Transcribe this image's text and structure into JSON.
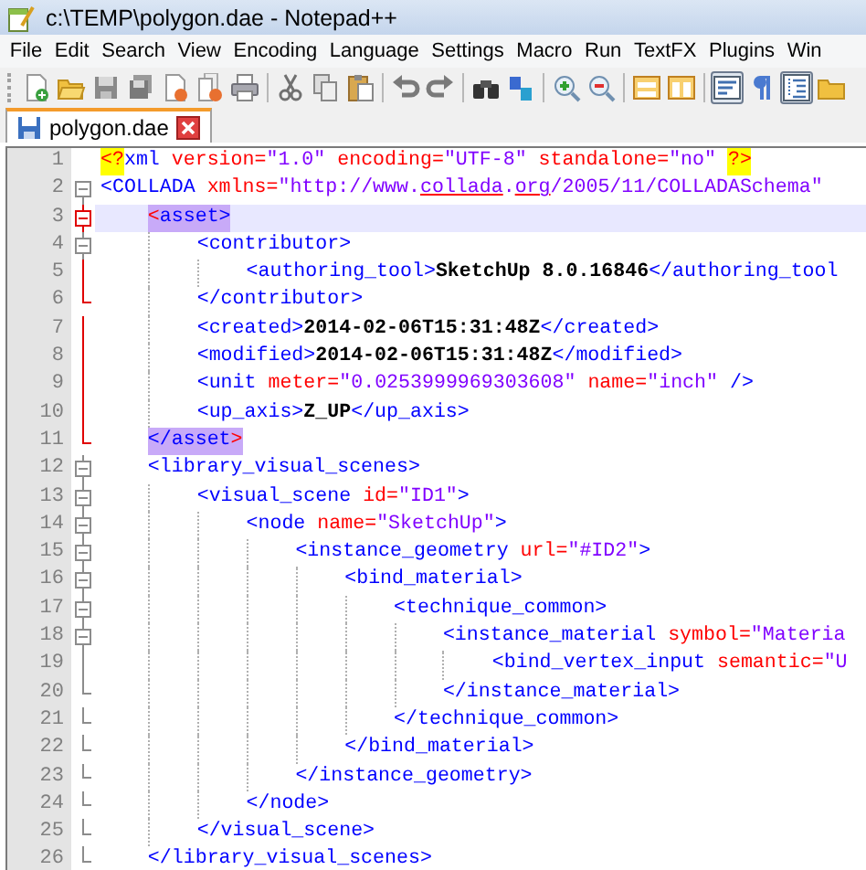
{
  "window": {
    "title": "c:\\TEMP\\polygon.dae - Notepad++"
  },
  "menu": [
    "File",
    "Edit",
    "Search",
    "View",
    "Encoding",
    "Language",
    "Settings",
    "Macro",
    "Run",
    "TextFX",
    "Plugins",
    "Win"
  ],
  "toolbar": [
    {
      "kind": "button",
      "pressed": false
    },
    {
      "kind": "button",
      "pressed": false
    },
    {
      "kind": "button",
      "pressed": false
    },
    {
      "kind": "button",
      "pressed": false
    },
    {
      "kind": "button",
      "pressed": false
    },
    {
      "kind": "button",
      "pressed": false
    },
    {
      "kind": "button",
      "pressed": false
    },
    {
      "kind": "separator"
    },
    {
      "kind": "button",
      "pressed": false
    },
    {
      "kind": "button",
      "pressed": false
    },
    {
      "kind": "button",
      "pressed": false
    },
    {
      "kind": "separator"
    },
    {
      "kind": "button",
      "pressed": false
    },
    {
      "kind": "button",
      "pressed": false
    },
    {
      "kind": "separator"
    },
    {
      "kind": "button",
      "pressed": false
    },
    {
      "kind": "button",
      "pressed": false
    },
    {
      "kind": "separator"
    },
    {
      "kind": "button",
      "pressed": false
    },
    {
      "kind": "button",
      "pressed": false
    },
    {
      "kind": "separator"
    },
    {
      "kind": "button",
      "pressed": false
    },
    {
      "kind": "button",
      "pressed": false
    },
    {
      "kind": "separator"
    },
    {
      "kind": "button",
      "pressed": true
    },
    {
      "kind": "button",
      "pressed": false
    },
    {
      "kind": "button",
      "pressed": true
    },
    {
      "kind": "button",
      "pressed": false
    }
  ],
  "tabs": [
    {
      "label": "polygon.dae",
      "selected": true
    }
  ],
  "editor": {
    "lines": [
      {
        "number": "1",
        "current": false,
        "tokens": [
          {
            "kind": "pi",
            "text": "<?",
            "highlighted": true
          },
          {
            "kind": "tag",
            "text": "xml "
          },
          {
            "kind": "attr",
            "text": "version="
          },
          {
            "kind": "value",
            "text": "\"1.0\""
          },
          {
            "kind": "attr",
            "text": " encoding="
          },
          {
            "kind": "value",
            "text": "\"UTF-8\""
          },
          {
            "kind": "attr",
            "text": " standalone="
          },
          {
            "kind": "value",
            "text": "\"no\" "
          },
          {
            "kind": "pi",
            "text": "?>",
            "highlighted": true
          }
        ]
      },
      {
        "number": "2",
        "current": false,
        "fold": {
          "kind": "open",
          "active": false
        },
        "tokens": [
          {
            "kind": "tag",
            "text": "<COLLADA "
          },
          {
            "kind": "attr",
            "text": "xmlns="
          },
          {
            "kind": "value",
            "text": "\"http://www."
          },
          {
            "kind": "value",
            "text": "collada",
            "misspelled": true
          },
          {
            "kind": "value",
            "text": "."
          },
          {
            "kind": "value",
            "text": "org",
            "misspelled": true
          },
          {
            "kind": "value",
            "text": "/2005/11/COLLADASchema\""
          }
        ]
      },
      {
        "number": "3",
        "current": true,
        "fold": {
          "kind": "open",
          "active": true
        },
        "tokens": [
          {
            "kind": "brace",
            "text": "    <",
            "highlighted": true
          },
          {
            "kind": "tag",
            "text": "asset>",
            "highlighted": true
          }
        ]
      },
      {
        "number": "4",
        "current": false,
        "fold": {
          "kind": "open",
          "active": false
        },
        "tokens": [
          {
            "kind": "tag",
            "text": "        <contributor>"
          }
        ]
      },
      {
        "number": "5",
        "current": false,
        "fold": {
          "kind": "body",
          "active": true
        },
        "tokens": [
          {
            "kind": "tag",
            "text": "            <authoring_tool>"
          },
          {
            "kind": "text",
            "text": "SketchUp 8.0.16846"
          },
          {
            "kind": "tag",
            "text": "</authoring_tool"
          }
        ]
      },
      {
        "number": "6",
        "current": false,
        "fold": {
          "kind": "end",
          "active": true
        },
        "tokens": [
          {
            "kind": "tag",
            "text": "        </contributor>"
          }
        ]
      },
      {
        "number": "7",
        "current": false,
        "fold": {
          "kind": "body",
          "active": true
        },
        "tokens": [
          {
            "kind": "tag",
            "text": "        <created>"
          },
          {
            "kind": "text",
            "text": "2014-02-06T15:31:48Z"
          },
          {
            "kind": "tag",
            "text": "</created>"
          }
        ]
      },
      {
        "number": "8",
        "current": false,
        "fold": {
          "kind": "body",
          "active": true
        },
        "tokens": [
          {
            "kind": "tag",
            "text": "        <modified>"
          },
          {
            "kind": "text",
            "text": "2014-02-06T15:31:48Z"
          },
          {
            "kind": "tag",
            "text": "</modified>"
          }
        ]
      },
      {
        "number": "9",
        "current": false,
        "fold": {
          "kind": "body",
          "active": true
        },
        "tokens": [
          {
            "kind": "tag",
            "text": "        <unit "
          },
          {
            "kind": "attr",
            "text": "meter="
          },
          {
            "kind": "value",
            "text": "\"0.0253999969303608\""
          },
          {
            "kind": "attr",
            "text": " name="
          },
          {
            "kind": "value",
            "text": "\"inch\""
          },
          {
            "kind": "tag",
            "text": " />"
          }
        ]
      },
      {
        "number": "10",
        "current": false,
        "fold": {
          "kind": "body",
          "active": true
        },
        "tokens": [
          {
            "kind": "tag",
            "text": "        <up_axis>"
          },
          {
            "kind": "text",
            "text": "Z_UP"
          },
          {
            "kind": "tag",
            "text": "</up_axis>"
          }
        ]
      },
      {
        "number": "11",
        "current": false,
        "fold": {
          "kind": "end",
          "active": true
        },
        "tokens": [
          {
            "kind": "tag",
            "text": "    </asset",
            "highlighted": true
          },
          {
            "kind": "brace",
            "text": ">",
            "highlighted": true
          }
        ]
      },
      {
        "number": "12",
        "current": false,
        "fold": {
          "kind": "open",
          "active": false
        },
        "tokens": [
          {
            "kind": "tag",
            "text": "    <library_visual_scenes>"
          }
        ]
      },
      {
        "number": "13",
        "current": false,
        "fold": {
          "kind": "open",
          "active": false
        },
        "tokens": [
          {
            "kind": "tag",
            "text": "        <visual_scene "
          },
          {
            "kind": "attr",
            "text": "id="
          },
          {
            "kind": "value",
            "text": "\"ID1\""
          },
          {
            "kind": "tag",
            "text": ">"
          }
        ]
      },
      {
        "number": "14",
        "current": false,
        "fold": {
          "kind": "open",
          "active": false
        },
        "tokens": [
          {
            "kind": "tag",
            "text": "            <node "
          },
          {
            "kind": "attr",
            "text": "name="
          },
          {
            "kind": "value",
            "text": "\"SketchUp\""
          },
          {
            "kind": "tag",
            "text": ">"
          }
        ]
      },
      {
        "number": "15",
        "current": false,
        "fold": {
          "kind": "open",
          "active": false
        },
        "tokens": [
          {
            "kind": "tag",
            "text": "                <instance_geometry "
          },
          {
            "kind": "attr",
            "text": "url="
          },
          {
            "kind": "value",
            "text": "\"#ID2\""
          },
          {
            "kind": "tag",
            "text": ">"
          }
        ]
      },
      {
        "number": "16",
        "current": false,
        "fold": {
          "kind": "open",
          "active": false
        },
        "tokens": [
          {
            "kind": "tag",
            "text": "                    <bind_material>"
          }
        ]
      },
      {
        "number": "17",
        "current": false,
        "fold": {
          "kind": "open",
          "active": false
        },
        "tokens": [
          {
            "kind": "tag",
            "text": "                        <technique_common>"
          }
        ]
      },
      {
        "number": "18",
        "current": false,
        "fold": {
          "kind": "open",
          "active": false
        },
        "tokens": [
          {
            "kind": "tag",
            "text": "                            <instance_material "
          },
          {
            "kind": "attr",
            "text": "symbol="
          },
          {
            "kind": "value",
            "text": "\"Materia"
          }
        ]
      },
      {
        "number": "19",
        "current": false,
        "fold": {
          "kind": "body",
          "active": false
        },
        "tokens": [
          {
            "kind": "tag",
            "text": "                                <bind_vertex_input "
          },
          {
            "kind": "attr",
            "text": "semantic="
          },
          {
            "kind": "value",
            "text": "\"U"
          }
        ]
      },
      {
        "number": "20",
        "current": false,
        "fold": {
          "kind": "end",
          "active": false
        },
        "tokens": [
          {
            "kind": "tag",
            "text": "                            </instance_material>"
          }
        ]
      },
      {
        "number": "21",
        "current": false,
        "fold": {
          "kind": "end",
          "active": false
        },
        "tokens": [
          {
            "kind": "tag",
            "text": "                        </technique_common>"
          }
        ]
      },
      {
        "number": "22",
        "current": false,
        "fold": {
          "kind": "end",
          "active": false
        },
        "tokens": [
          {
            "kind": "tag",
            "text": "                    </bind_material>"
          }
        ]
      },
      {
        "number": "23",
        "current": false,
        "fold": {
          "kind": "end",
          "active": false
        },
        "tokens": [
          {
            "kind": "tag",
            "text": "                </instance_geometry>"
          }
        ]
      },
      {
        "number": "24",
        "current": false,
        "fold": {
          "kind": "end",
          "active": false
        },
        "tokens": [
          {
            "kind": "tag",
            "text": "            </node>"
          }
        ]
      },
      {
        "number": "25",
        "current": false,
        "fold": {
          "kind": "end",
          "active": false
        },
        "tokens": [
          {
            "kind": "tag",
            "text": "        </visual_scene>"
          }
        ]
      },
      {
        "number": "26",
        "current": false,
        "fold": {
          "kind": "end",
          "active": false
        },
        "tokens": [
          {
            "kind": "tag",
            "text": "    </library_visual_scenes>"
          }
        ]
      }
    ]
  }
}
